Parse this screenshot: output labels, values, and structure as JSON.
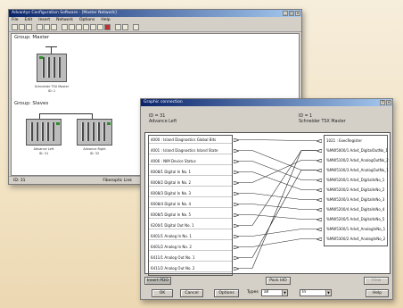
{
  "main_window": {
    "title": "Advantys Configuration Software - [Master Network]",
    "menu": [
      "File",
      "Edit",
      "Insert",
      "Network",
      "Options",
      "Help"
    ],
    "group_master_label": "Group: Master",
    "group_slaves_label": "Group: Slaves",
    "master_device": {
      "name": "Schneider TSX Master",
      "id": "ID: 1"
    },
    "slave_devices": [
      {
        "name": "Advance Left",
        "id": "ID: 31"
      },
      {
        "name": "Advance Right",
        "id": "ID: 32"
      }
    ],
    "status_left": "ID: 31",
    "status_right": "Fiberoptic Link"
  },
  "conn_window": {
    "title": "Graphic connection",
    "left_header": {
      "id": "ID = 31",
      "name": "Advance Left"
    },
    "right_header": {
      "id": "ID = 1",
      "name": "Schneider TSX Master"
    },
    "left_items": [
      "4000 : Island Diagnostics Global Bits",
      "4001 : Island Diagnostics Island State",
      "4006 : NIM Device Status",
      "6008/1 Digital In No. 1",
      "6008/2 Digital In No. 2",
      "6008/3 Digital In No. 3",
      "6008/4 Digital In No. 4",
      "6008/5 Digital In No. 5",
      "6200/1 Digital Out No. 1",
      "6401/1 Analog In No. 1",
      "6401/2 Analog In No. 2",
      "6411/1 Analog Out No. 1",
      "6411/2 Analog Out No. 2"
    ],
    "right_items": [
      "1021 : ExecRegister",
      "%MW5000/1 Adv4_DigitalOutNo_1",
      "%MW5100/2 Adv4_AnalogOutNo_2",
      "%MW5100/3 Adv4_AnalogOutNo_1",
      "%MW5200/1 Adv4_DigitalInNo_1",
      "%MW5200/2 Adv4_DigitalInNo_2",
      "%MW5200/3 Adv4_DigitalInNo_3",
      "%MW5200/4 Adv4_DigitalInNo_4",
      "%MW5200/5 Adv4_DigitalInNo_5",
      "%MW5300/1 Adv4_AnalogInNo_1",
      "%MW5300/2 Adv4_AnalogInNo_2"
    ],
    "connections": [
      [
        0,
        0
      ],
      [
        1,
        3
      ],
      [
        2,
        4
      ],
      [
        3,
        5
      ],
      [
        4,
        2
      ],
      [
        5,
        6
      ],
      [
        6,
        7
      ],
      [
        7,
        8
      ],
      [
        8,
        1
      ],
      [
        9,
        9
      ],
      [
        10,
        10
      ],
      [
        11,
        3
      ],
      [
        12,
        1
      ]
    ],
    "pin_color": "#3a7bd5",
    "buttons": {
      "insert_pdo": "Insert PDO",
      "pack_ldo": "Pack ldO",
      "view": "View",
      "ok": "OK",
      "cancel": "Cancel",
      "options": "Options",
      "help": "Help"
    },
    "types_label": "Types",
    "types_value": "all",
    "dir_value": "In"
  }
}
